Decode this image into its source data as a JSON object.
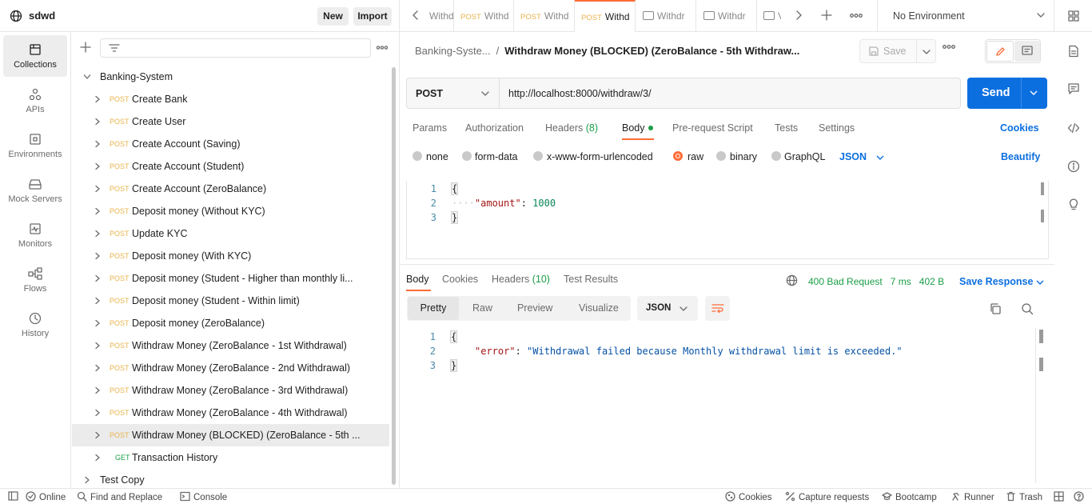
{
  "workspace": {
    "name": "sdwd",
    "new_label": "New",
    "import_label": "Import"
  },
  "tabs": [
    {
      "method": "",
      "label": "Withd"
    },
    {
      "method": "POST",
      "label": "Withd"
    },
    {
      "method": "POST",
      "label": "Withd"
    },
    {
      "method": "POST",
      "label": "Withd"
    },
    {
      "method": "",
      "label": "Withdr"
    },
    {
      "method": "",
      "label": "Withdr"
    },
    {
      "method": "",
      "label": "V"
    }
  ],
  "environment": {
    "label": "No Environment"
  },
  "rail": [
    {
      "label": "Collections"
    },
    {
      "label": "APIs"
    },
    {
      "label": "Environments"
    },
    {
      "label": "Mock Servers"
    },
    {
      "label": "Monitors"
    },
    {
      "label": "Flows"
    },
    {
      "label": "History"
    }
  ],
  "collection": {
    "name": "Banking-System",
    "requests": [
      {
        "method": "POST",
        "name": "Create Bank"
      },
      {
        "method": "POST",
        "name": "Create User"
      },
      {
        "method": "POST",
        "name": "Create Account (Saving)"
      },
      {
        "method": "POST",
        "name": "Create Account (Student)"
      },
      {
        "method": "POST",
        "name": "Create Account (ZeroBalance)"
      },
      {
        "method": "POST",
        "name": "Deposit money (Without KYC)"
      },
      {
        "method": "POST",
        "name": "Update KYC"
      },
      {
        "method": "POST",
        "name": "Deposit money (With KYC)"
      },
      {
        "method": "POST",
        "name": "Deposit money (Student - Higher than monthly li..."
      },
      {
        "method": "POST",
        "name": "Deposit money (Student - Within limit)"
      },
      {
        "method": "POST",
        "name": "Deposit money (ZeroBalance)"
      },
      {
        "method": "POST",
        "name": "Withdraw Money (ZeroBalance - 1st Withdrawal)"
      },
      {
        "method": "POST",
        "name": "Withdraw Money (ZeroBalance - 2nd Withdrawal)"
      },
      {
        "method": "POST",
        "name": "Withdraw Money (ZeroBalance - 3rd Withdrawal)"
      },
      {
        "method": "POST",
        "name": "Withdraw Money (ZeroBalance - 4th Withdrawal)"
      },
      {
        "method": "POST",
        "name": "Withdraw Money (BLOCKED) (ZeroBalance - 5th ..."
      },
      {
        "method": "GET",
        "name": "Transaction History"
      }
    ],
    "other": "Test Copy"
  },
  "breadcrumb": {
    "parent": "Banking-Syste...",
    "separator": "/",
    "current": "Withdraw Money (BLOCKED) (ZeroBalance - 5th Withdraw..."
  },
  "save_label": "Save",
  "request": {
    "method": "POST",
    "url": "http://localhost:8000/withdraw/3/",
    "send_label": "Send"
  },
  "req_tabs": {
    "params": "Params",
    "authorization": "Authorization",
    "headers": "Headers",
    "headers_count": "(8)",
    "body": "Body",
    "prerequest": "Pre-request Script",
    "tests": "Tests",
    "settings": "Settings",
    "cookies": "Cookies"
  },
  "body_options": {
    "none": "none",
    "form_data": "form-data",
    "urlencoded": "x-www-form-urlencoded",
    "raw": "raw",
    "binary": "binary",
    "graphql": "GraphQL",
    "lang": "JSON",
    "beautify": "Beautify"
  },
  "request_body": {
    "lines": [
      "1",
      "2",
      "3"
    ],
    "open": "{",
    "key": "\"amount\"",
    "colon": ": ",
    "value": "1000",
    "close": "}",
    "indent": "····"
  },
  "resp_tabs": {
    "body": "Body",
    "cookies": "Cookies",
    "headers": "Headers",
    "headers_count": "(10)",
    "tests": "Test Results"
  },
  "response_meta": {
    "status": "400 Bad Request",
    "time": "7 ms",
    "size": "402 B",
    "save": "Save Response"
  },
  "format": {
    "pretty": "Pretty",
    "raw": "Raw",
    "preview": "Preview",
    "visualize": "Visualize",
    "lang": "JSON"
  },
  "response_body": {
    "lines": [
      "1",
      "2",
      "3"
    ],
    "open": "{",
    "key": "\"error\"",
    "colon": ": ",
    "value": "\"Withdrawal failed because Monthly withdrawal limit is exceeded.\"",
    "close": "}"
  },
  "status_bar": {
    "online": "Online",
    "find": "Find and Replace",
    "console": "Console",
    "cookies": "Cookies",
    "capture": "Capture requests",
    "bootcamp": "Bootcamp",
    "runner": "Runner",
    "trash": "Trash"
  },
  "colors": {
    "accent": "#ff6c37",
    "primary": "#0c6fe0",
    "post": "#e9b44c",
    "get": "#1a9e46"
  }
}
